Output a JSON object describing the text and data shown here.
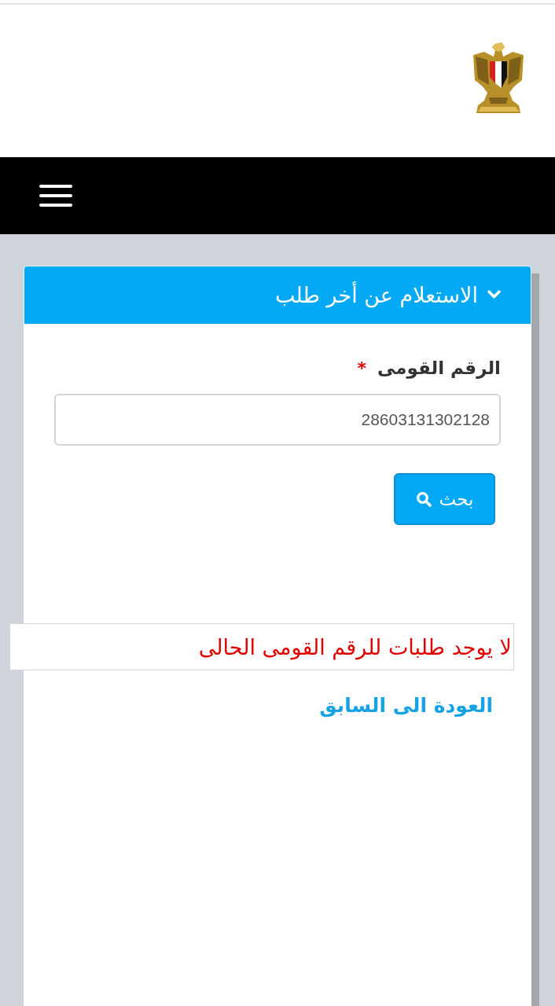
{
  "panel": {
    "title": "الاستعلام عن أخر طلب",
    "expanded": true
  },
  "form": {
    "label": "الرقم القومى",
    "required_mark": "*",
    "value": "28603131302128",
    "button": "بحث"
  },
  "message": "لا يوجد طلبات للرقم القومى الحالى",
  "back_link": "العودة الى السابق"
}
